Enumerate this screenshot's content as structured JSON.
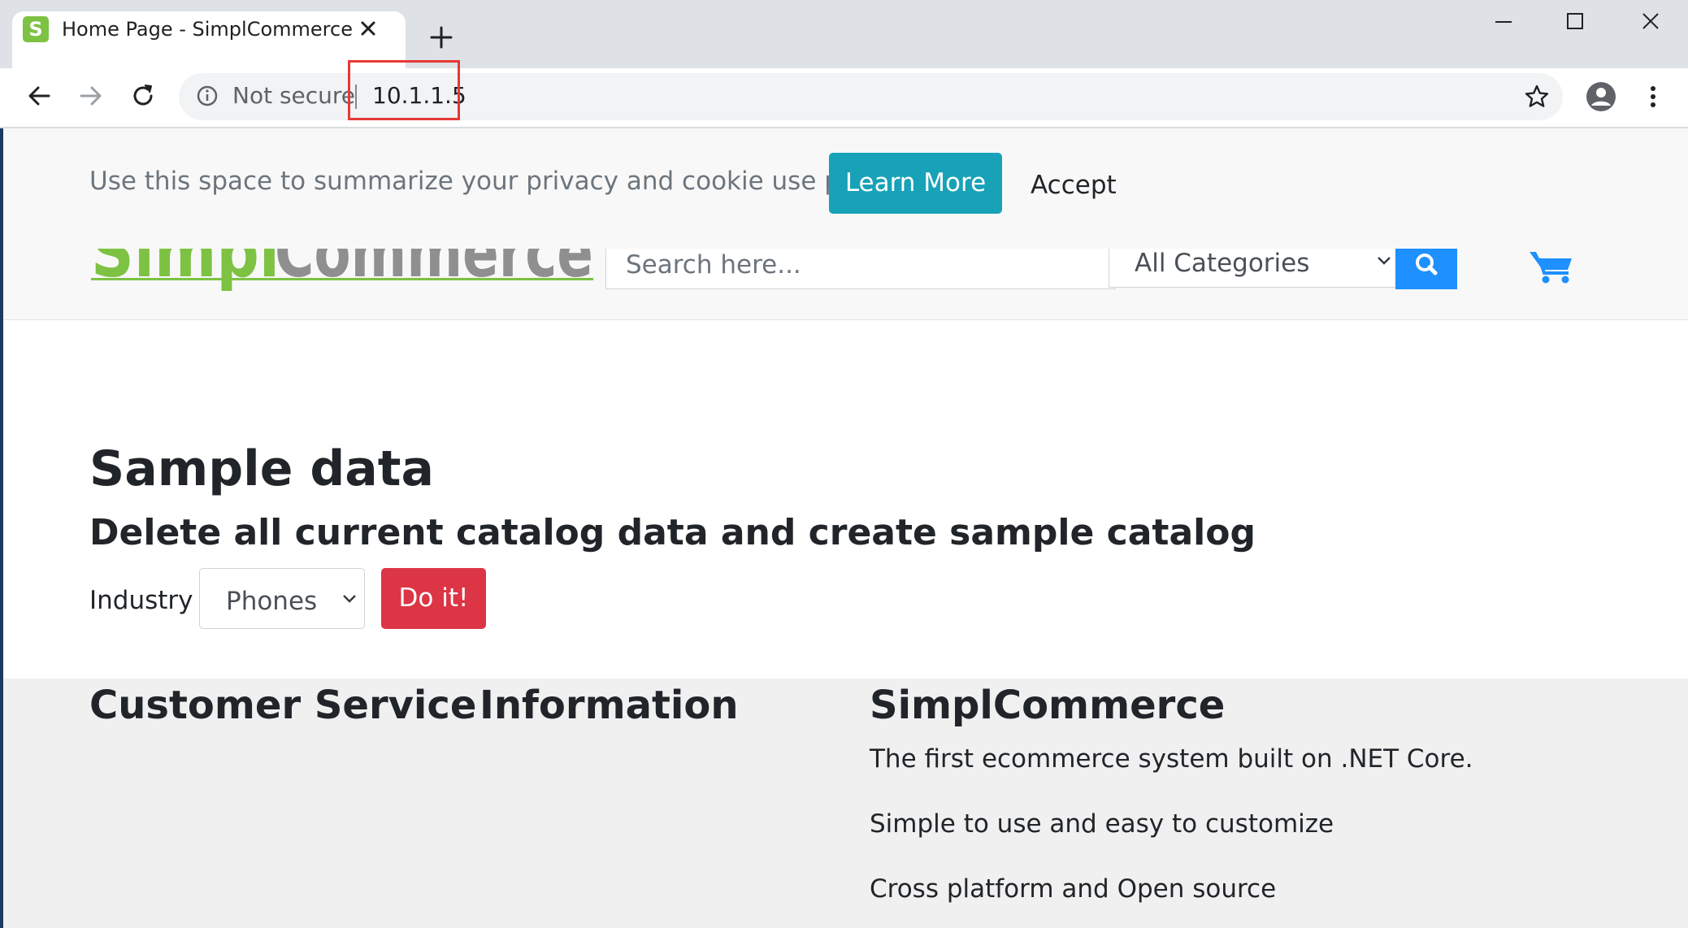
{
  "browser": {
    "tab_title": "Home Page - SimplCommerce",
    "favicon_letter": "S",
    "security_label": "Not secure",
    "url": "10.1.1.5"
  },
  "cookie_banner": {
    "text": "Use this space to summarize your privacy and cookie use policy.",
    "learn_more": "Learn More",
    "accept": "Accept"
  },
  "header": {
    "logo_text": "SimplCommerce",
    "search_placeholder": "Search here...",
    "category_selected": "All Categories"
  },
  "main": {
    "title": "Sample data",
    "subtitle": "Delete all current catalog data and create sample catalog",
    "industry_label": "Industry",
    "industry_selected": "Phones",
    "submit_label": "Do it!"
  },
  "footer": {
    "columns": [
      {
        "heading": "Customer Service"
      },
      {
        "heading": "Information"
      },
      {
        "heading": "SimplCommerce",
        "lines": [
          "The first ecommerce system built on .NET Core.",
          "Simple to use and easy to customize",
          "Cross platform and Open source"
        ]
      }
    ]
  },
  "colors": {
    "learn_more_bg": "#17a2b8",
    "submit_bg": "#dc3545",
    "search_button_bg": "#1e90ff",
    "logo_green": "#7dc243",
    "url_highlight": "#e53935"
  }
}
